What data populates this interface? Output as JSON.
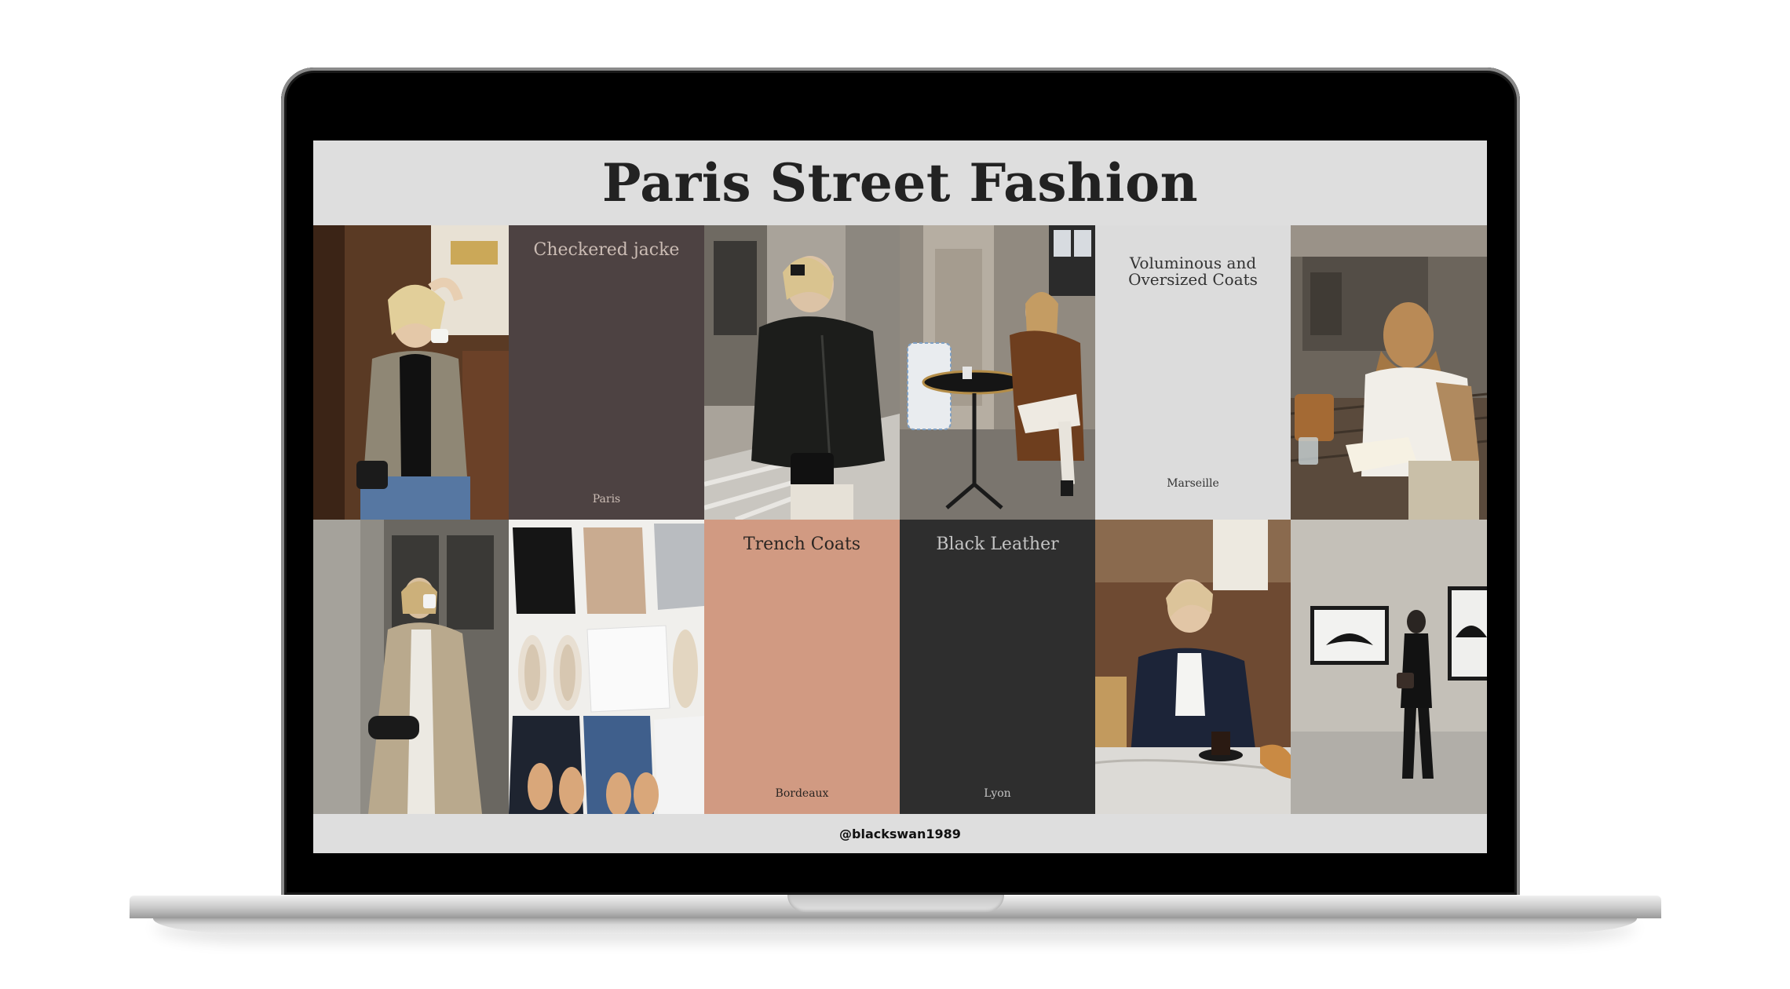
{
  "board": {
    "title": "Paris Street Fashion",
    "footer": "@blackswan1989"
  },
  "tiles": [
    {
      "kind": "photo",
      "subject": "woman in houndstooth blazer drinking coffee"
    },
    {
      "kind": "text",
      "heading": "Checkered jacke",
      "place": "Paris",
      "bg": "#4d4242",
      "fg": "#cbbcb4"
    },
    {
      "kind": "photo",
      "subject": "woman in black leather jacket on street"
    },
    {
      "kind": "photo",
      "subject": "woman in brown coat at cafe table"
    },
    {
      "kind": "text",
      "heading_line1": "Voluminous and",
      "heading_line2": "Oversized Coats",
      "place": "Marseille",
      "bg": "#dcdcdc",
      "fg": "#333333"
    },
    {
      "kind": "photo",
      "subject": "woman reading at wooden terrace table"
    },
    {
      "kind": "photo",
      "subject": "woman in trench coat in doorway"
    },
    {
      "kind": "photo",
      "subject": "flat lay of sweaters shoes and jeans"
    },
    {
      "kind": "text",
      "heading": "Trench Coats",
      "place": "Bordeaux",
      "bg": "#d19a82",
      "fg": "#2a2522"
    },
    {
      "kind": "text",
      "heading": "Black Leather",
      "place": "Lyon",
      "bg": "#2e2e2e",
      "fg": "#c4c4c4"
    },
    {
      "kind": "photo",
      "subject": "woman in black blazer at cafe"
    },
    {
      "kind": "photo",
      "subject": "woman viewing photos in gallery"
    }
  ],
  "colors": {
    "screen_bg": "#dedede",
    "title_text": "#222222",
    "laptop_bezel": "#000000"
  }
}
